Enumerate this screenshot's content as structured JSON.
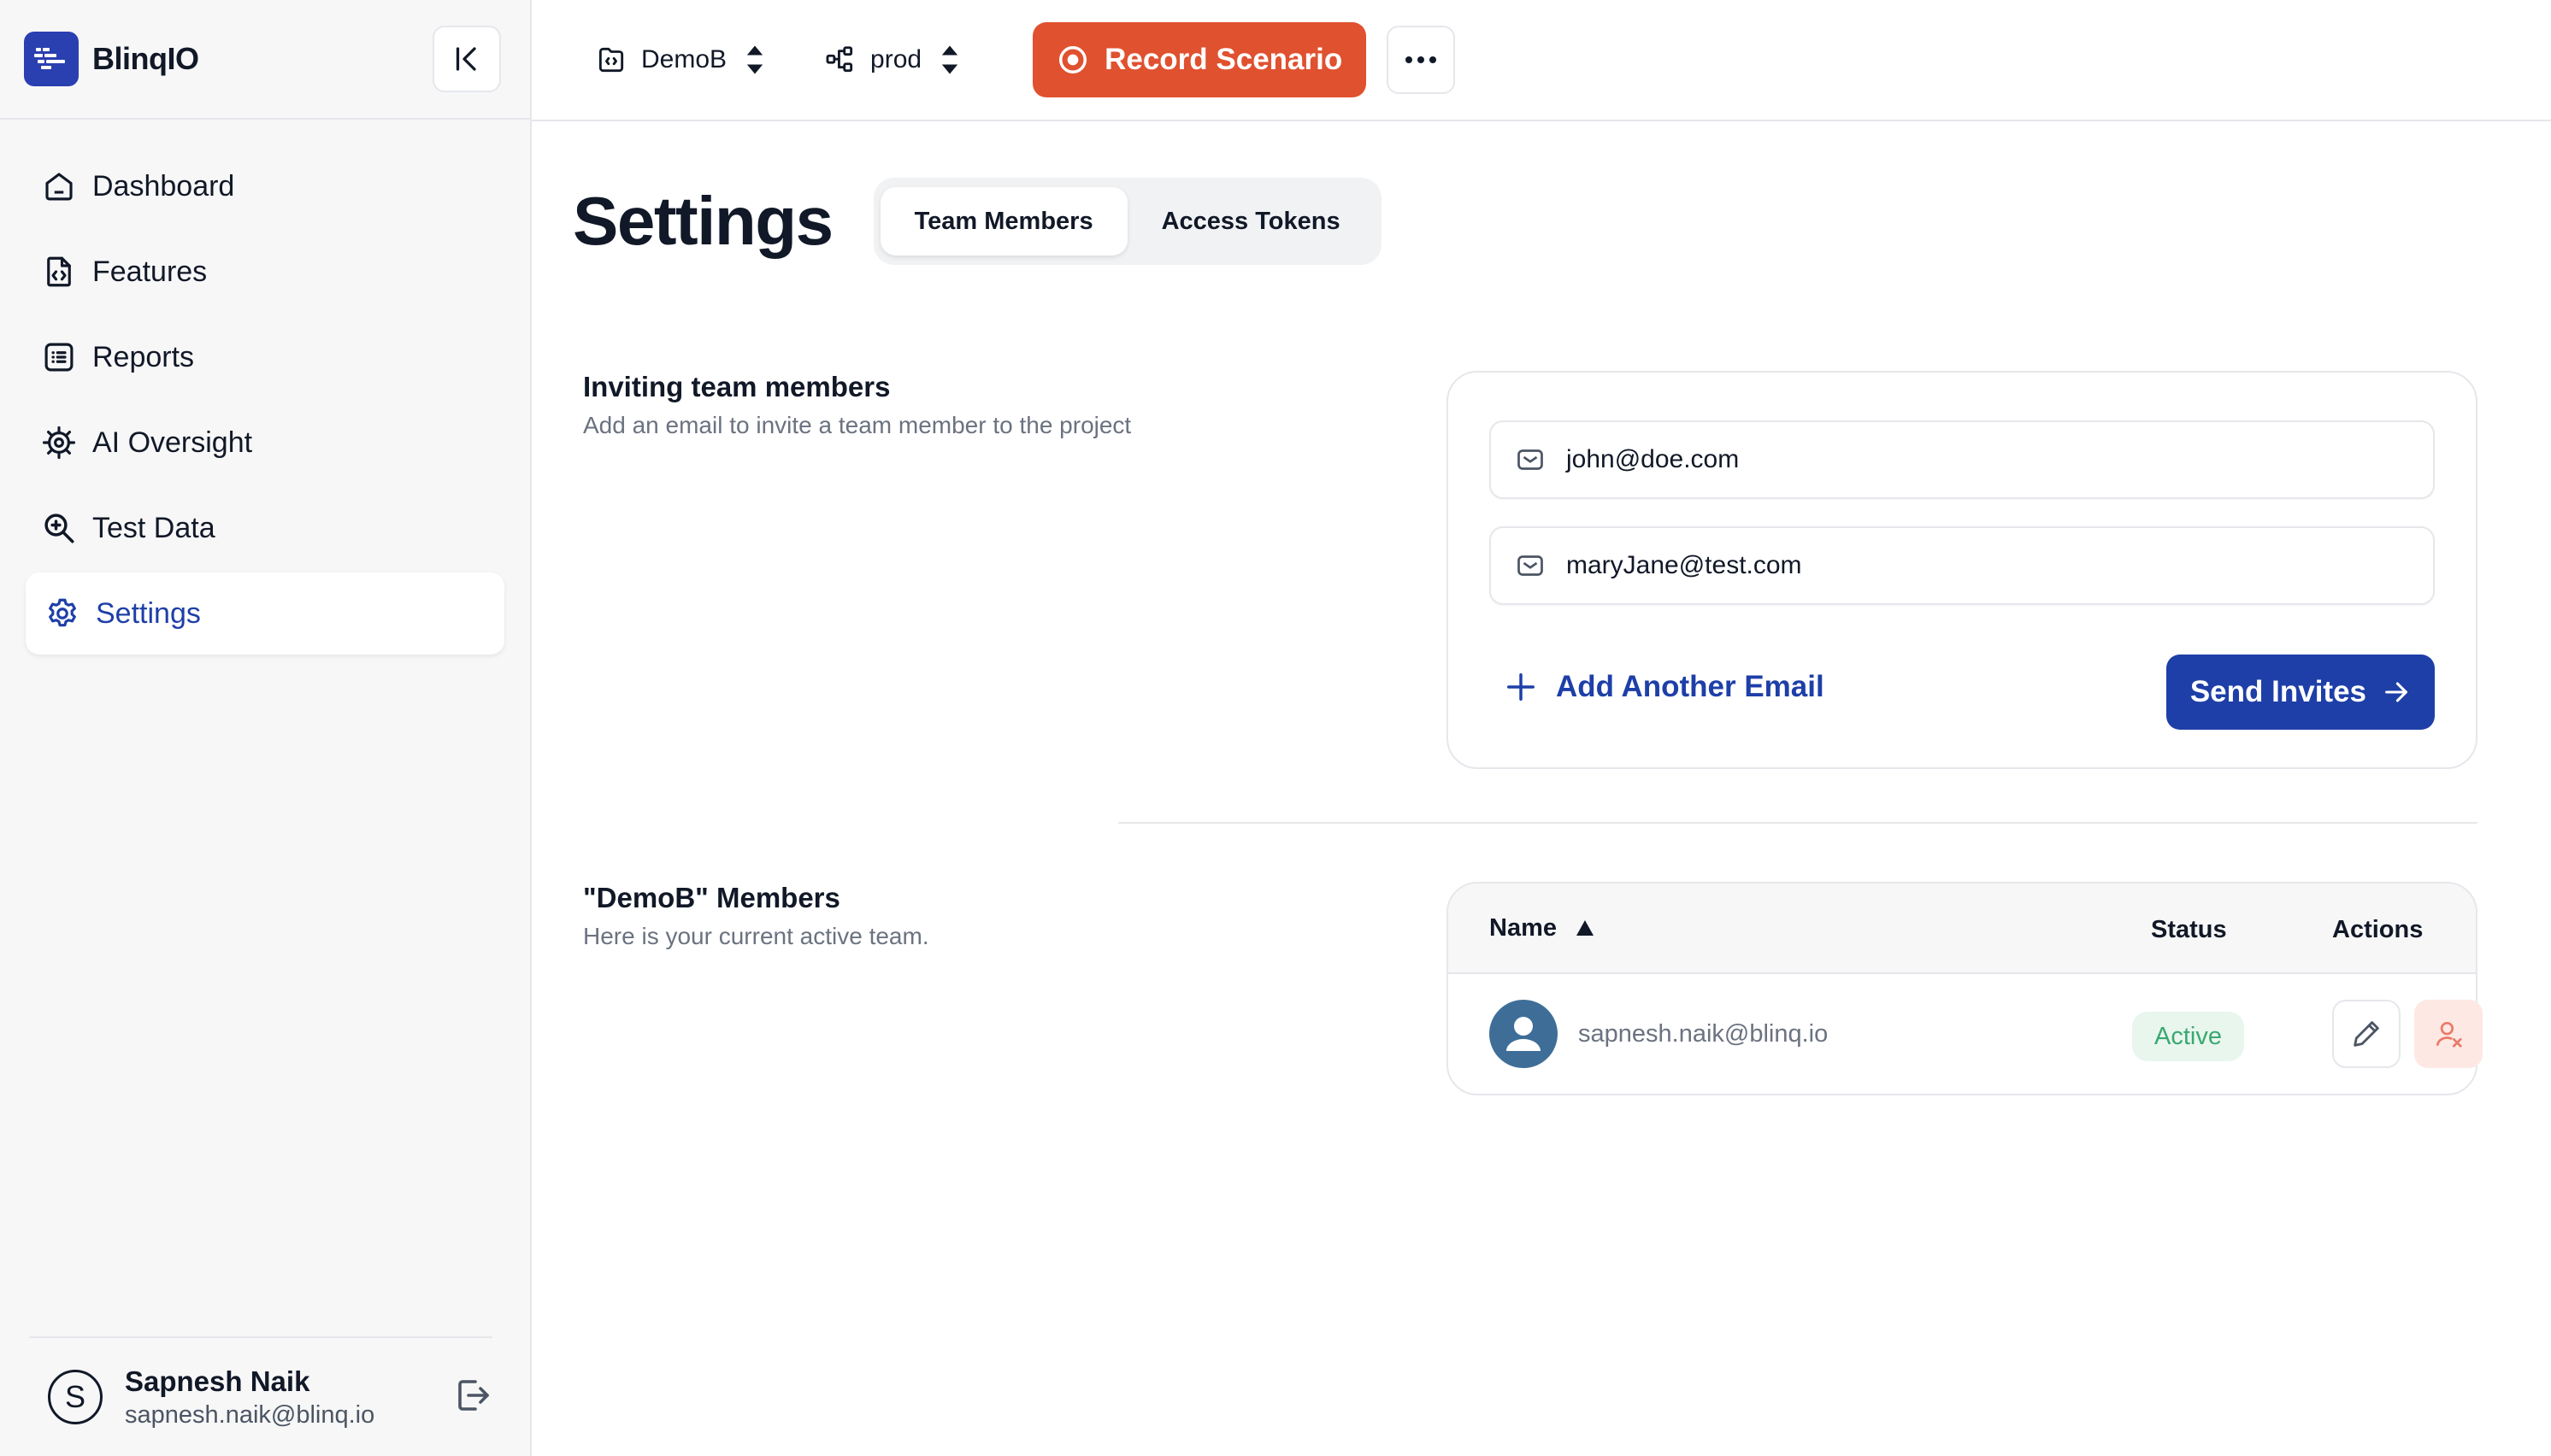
{
  "brand": {
    "name": "BlinqIO",
    "accent": "#2a3fb0"
  },
  "sidebar": {
    "items": [
      {
        "label": "Dashboard",
        "icon": "home-icon"
      },
      {
        "label": "Features",
        "icon": "file-code-icon"
      },
      {
        "label": "Reports",
        "icon": "list-icon"
      },
      {
        "label": "AI Oversight",
        "icon": "chip-icon"
      },
      {
        "label": "Test Data",
        "icon": "search-data-icon"
      },
      {
        "label": "Settings",
        "icon": "gear-icon",
        "active": true
      }
    ],
    "user": {
      "initial": "S",
      "name": "Sapnesh Naik",
      "email": "sapnesh.naik@blinq.io"
    }
  },
  "topbar": {
    "project": "DemoB",
    "environment": "prod",
    "record_label": "Record Scenario",
    "record_color": "#e0512f"
  },
  "page": {
    "title": "Settings",
    "tabs": [
      {
        "label": "Team Members",
        "active": true
      },
      {
        "label": "Access Tokens",
        "active": false
      }
    ]
  },
  "invite": {
    "title": "Inviting team members",
    "subtitle": "Add an email to invite a team member to the project",
    "emails": [
      "john@doe.com",
      "maryJane@test.com"
    ],
    "add_label": "Add Another Email",
    "send_label": "Send Invites"
  },
  "members": {
    "title": "\"DemoB\" Members",
    "subtitle": "Here is your current active team.",
    "columns": {
      "name": "Name",
      "status": "Status",
      "actions": "Actions"
    },
    "rows": [
      {
        "email": "sapnesh.naik@blinq.io",
        "status": "Active"
      }
    ]
  }
}
